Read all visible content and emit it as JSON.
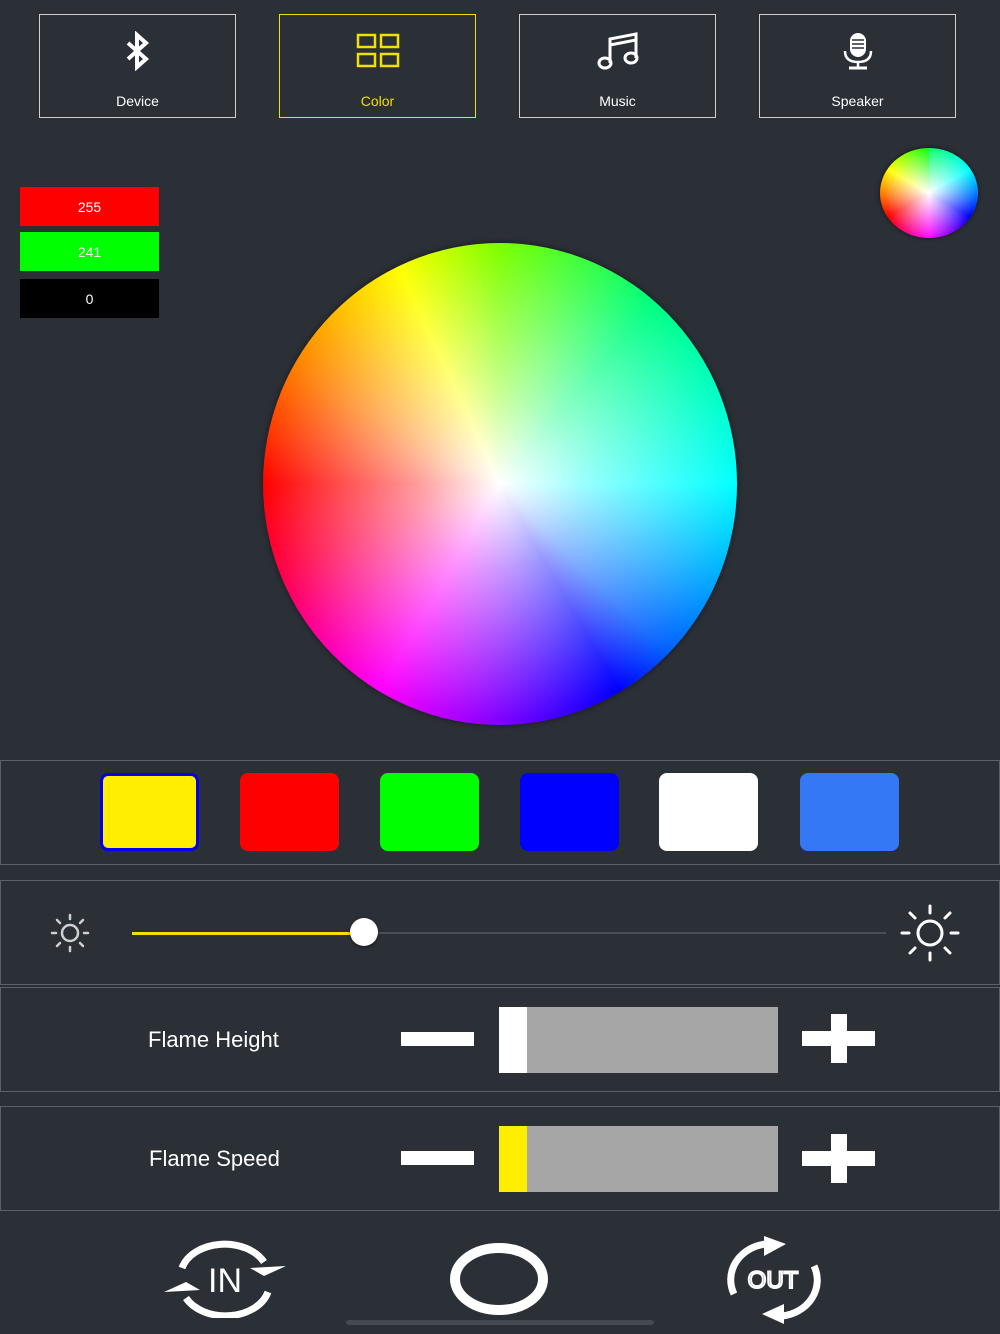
{
  "tabs": [
    {
      "label": "Device",
      "icon": "bluetooth-icon",
      "active": false
    },
    {
      "label": "Color",
      "icon": "grid-icon",
      "active": true
    },
    {
      "label": "Music",
      "icon": "music-note-icon",
      "active": false
    },
    {
      "label": "Speaker",
      "icon": "microphone-icon",
      "active": false
    }
  ],
  "rgb": {
    "red": "255",
    "green": "241",
    "blue": "0"
  },
  "colors": {
    "accent": "#f2e000",
    "background": "#2b2f36"
  },
  "swatches": [
    {
      "color": "#ffee00",
      "selected": true
    },
    {
      "color": "#ff0000",
      "selected": false
    },
    {
      "color": "#00ff00",
      "selected": false
    },
    {
      "color": "#0000ff",
      "selected": false
    },
    {
      "color": "#ffffff",
      "selected": false
    },
    {
      "color": "#3478f6",
      "selected": false
    }
  ],
  "brightness": {
    "level_fraction": 0.3,
    "min_icon": "sun-small-icon",
    "max_icon": "sun-large-icon"
  },
  "flame_height": {
    "label": "Flame Height",
    "level_fraction": 0.1,
    "fill_color": "#ffffff"
  },
  "flame_speed": {
    "label": "Flame Speed",
    "level_fraction": 0.1,
    "fill_color": "#ffee00"
  },
  "bottom_controls": {
    "in_label": "IN",
    "out_label": "OUT"
  }
}
